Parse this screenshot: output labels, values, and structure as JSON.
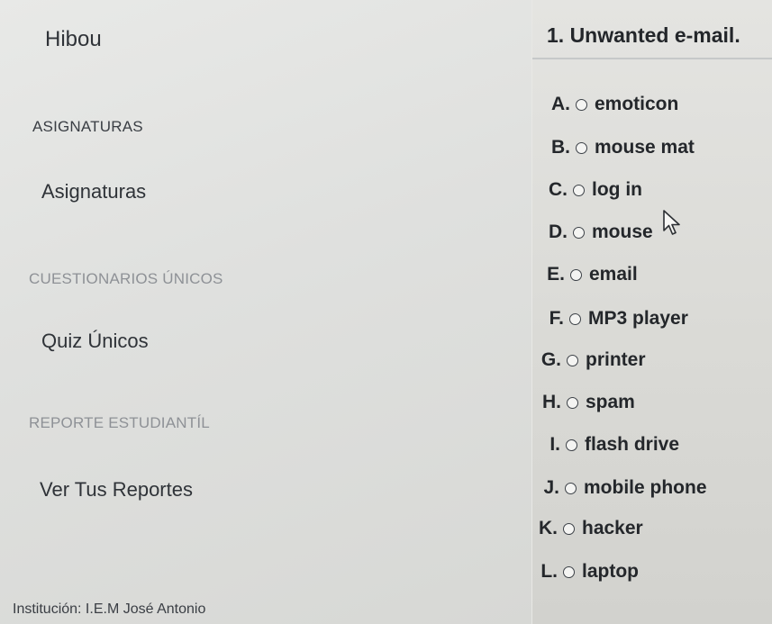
{
  "sidebar": {
    "brand": "Hibou",
    "sections": [
      {
        "heading": "ASIGNATURAS",
        "link": "Asignaturas"
      },
      {
        "heading": "CUESTIONARIOS ÚNICOS",
        "link": "Quiz Únicos"
      },
      {
        "heading": "REPORTE ESTUDIANTÍL",
        "link": "Ver Tus Reportes"
      }
    ],
    "footer": "Institución: I.E.M José Antonio"
  },
  "question": {
    "title": "1. Unwanted e-mail.",
    "choices": [
      {
        "letter": "A.",
        "text": "emoticon"
      },
      {
        "letter": "B.",
        "text": "mouse mat"
      },
      {
        "letter": "C.",
        "text": "log in"
      },
      {
        "letter": "D.",
        "text": "mouse"
      },
      {
        "letter": "E.",
        "text": "email"
      },
      {
        "letter": "F.",
        "text": "MP3 player"
      },
      {
        "letter": "G.",
        "text": "printer"
      },
      {
        "letter": "H.",
        "text": "spam"
      },
      {
        "letter": "I.",
        "text": "flash drive"
      },
      {
        "letter": "J.",
        "text": "mobile phone"
      },
      {
        "letter": "K.",
        "text": "hacker"
      },
      {
        "letter": "L.",
        "text": "laptop"
      }
    ]
  },
  "icons": {
    "radio": "radio-circle-icon",
    "cursor": "mouse-pointer-icon"
  }
}
